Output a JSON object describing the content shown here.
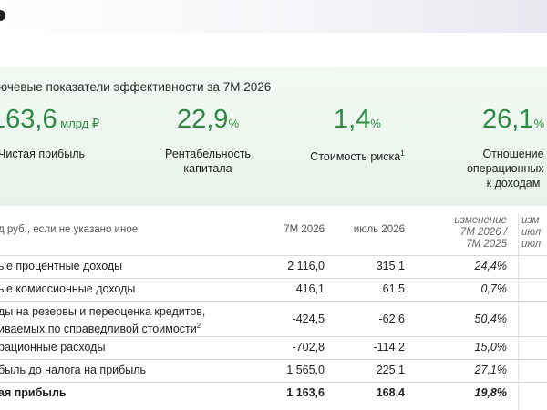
{
  "kpi": {
    "heading": "ючевые показатели эффективности за 7М 2026",
    "items": [
      {
        "value": "163,6",
        "unit": " млрд ₽",
        "label": "Чистая прибыль",
        "label2": ""
      },
      {
        "value": "22,9",
        "unit": "%",
        "label": "Рентабельность",
        "label2": "капитала"
      },
      {
        "value": "1,4",
        "unit": "%",
        "label": "Стоимость риска",
        "sup": "1",
        "label2": ""
      },
      {
        "value": "26,1",
        "unit": "%",
        "label": "Отношение",
        "label2": "операционных ра",
        "label3": "к доходам"
      }
    ]
  },
  "table": {
    "header": {
      "label": "д руб., если не указано иное",
      "col1": "7М 2026",
      "col2": "июль 2026",
      "col3_l1": "изменение",
      "col3_l2": "7М 2026 /",
      "col3_l3": "7М 2025",
      "col4_l1": "изм",
      "col4_l2": "июл",
      "col4_l3": "июл"
    },
    "rows": [
      {
        "label": "ые процентные доходы",
        "v1": "2 116,0",
        "v2": "315,1",
        "v3": "24,4%"
      },
      {
        "label": "ые комиссионные доходы",
        "v1": "416,1",
        "v2": "61,5",
        "v3": "0,7%"
      },
      {
        "label": "ды на резервы и переоценка кредитов,",
        "label2": "иваемых по справедливой стоимости",
        "sup": "2",
        "v1": "-424,5",
        "v2": "-62,6",
        "v3": "50,4%"
      },
      {
        "label": "рационные расходы",
        "v1": "-702,8",
        "v2": "-114,2",
        "v3": "15,0%"
      },
      {
        "label": "быль до налога на прибыль",
        "v1": "1 565,0",
        "v2": "225,1",
        "v3": "27,1%"
      },
      {
        "label": "ая прибыль",
        "v1": "1 163,6",
        "v2": "168,4",
        "v3": "19,8%"
      }
    ]
  }
}
